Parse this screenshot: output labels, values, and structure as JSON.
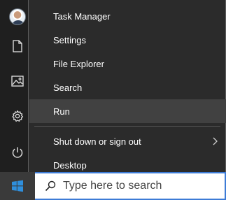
{
  "context_menu": {
    "items": [
      {
        "label": "Task Manager"
      },
      {
        "label": "Settings"
      },
      {
        "label": "File Explorer"
      },
      {
        "label": "Search"
      },
      {
        "label": "Run"
      },
      {
        "label": "Shut down or sign out",
        "has_submenu": true
      },
      {
        "label": "Desktop"
      }
    ],
    "highlighted_item": "Run"
  },
  "start_rail": {
    "icons": [
      "user-avatar-icon",
      "document-icon",
      "pictures-icon",
      "settings-gear-icon",
      "power-icon"
    ]
  },
  "taskbar": {
    "search_placeholder": "Type here to search",
    "start_icon": "windows-logo-icon"
  },
  "colors": {
    "menu_background": "#2b2b2b",
    "menu_hover": "#414141",
    "menu_text": "#ffffff",
    "search_border": "#3d7bd6",
    "rail_background": "#1f1f1f"
  }
}
